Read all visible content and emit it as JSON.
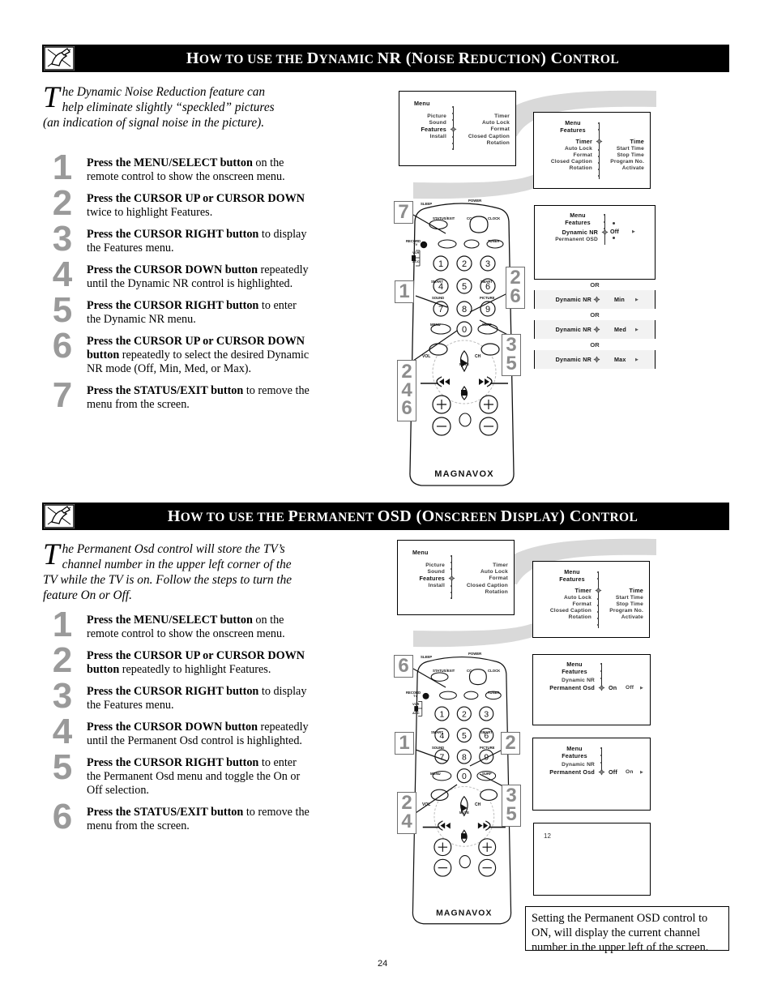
{
  "page": {
    "number": "24"
  },
  "sections": [
    {
      "icon": "tv-manual-icon",
      "title_parts": [
        {
          "t": "H",
          "cap": true
        },
        {
          "t": "OW TO USE THE ",
          "cap": false
        },
        {
          "t": "D",
          "cap": true
        },
        {
          "t": "YNAMIC ",
          "cap": false
        },
        {
          "t": "NR (",
          "cap": true
        },
        {
          "t": "N",
          "cap": true
        },
        {
          "t": "OISE ",
          "cap": false
        },
        {
          "t": "R",
          "cap": true
        },
        {
          "t": "EDUCTION) ",
          "cap": false
        },
        {
          "t": "C",
          "cap": true
        },
        {
          "t": "ONTROL",
          "cap": false
        }
      ],
      "title_plain": "HOW TO USE THE DYNAMIC NR (NOISE REDUCTION) CONTROL",
      "intro_dropcap": "T",
      "intro": "he Dynamic Noise Reduction feature can help eliminate slightly “speckled” pictures (an indication of signal noise in the picture).",
      "steps": [
        {
          "num": "1",
          "bold": "Press the MENU/SELECT button",
          "rest": " on the remote control to show the onscreen menu."
        },
        {
          "num": "2",
          "bold": "Press the CURSOR UP or CURSOR DOWN",
          "rest": " twice to highlight Features."
        },
        {
          "num": "3",
          "bold": "Press the CURSOR RIGHT button",
          "rest": " to display the Features menu."
        },
        {
          "num": "4",
          "bold": "Press the CURSOR DOWN button",
          "rest": " repeatedly until the Dynamic NR control is highlighted."
        },
        {
          "num": "5",
          "bold": "Press the CURSOR RIGHT button",
          "rest": " to enter the Dynamic NR menu."
        },
        {
          "num": "6",
          "bold": "Press the CURSOR UP or CURSOR DOWN button",
          "rest": " repeatedly to select the desired Dynamic NR mode (Off, Min, Med, or Max)."
        },
        {
          "num": "7",
          "bold": "Press the STATUS/EXIT button",
          "rest": " to remove the menu from the screen."
        }
      ]
    },
    {
      "icon": "tv-manual-icon",
      "title_plain": "HOW TO USE THE PERMANENT OSD (ONSCREEN DISPLAY) CONTROL",
      "intro_dropcap": "T",
      "intro": "he Permanent Osd control will store the TV’s channel number in the upper left corner of the TV while the TV is on.  Follow the steps to turn the feature On or Off.",
      "steps": [
        {
          "num": "1",
          "bold": "Press the MENU/SELECT button",
          "rest": " on the remote control to show the onscreen menu."
        },
        {
          "num": "2",
          "bold": "Press the CURSOR UP or CURSOR DOWN button",
          "rest": " repeatedly to highlight Features."
        },
        {
          "num": "3",
          "bold": "Press the CURSOR RIGHT button",
          "rest": " to display the Features menu."
        },
        {
          "num": "4",
          "bold": "Press the CURSOR DOWN button",
          "rest": " repeatedly until the Permanent Osd control is highlighted."
        },
        {
          "num": "5",
          "bold": "Press the CURSOR RIGHT button",
          "rest": " to enter the Permanent Osd menu and toggle the On or Off selection."
        },
        {
          "num": "6",
          "bold": "Press the STATUS/EXIT button",
          "rest": " to remove the menu from the screen."
        }
      ]
    }
  ],
  "osd": {
    "main_menu": {
      "title": "Menu",
      "left_items": [
        "Picture",
        "Sound",
        "Features",
        "Install"
      ],
      "highlighted": "Features",
      "right_items": [
        "Timer",
        "Auto Lock",
        "Format",
        "Closed Caption",
        "Rotation"
      ]
    },
    "features_menu": {
      "breadcrumb": [
        "Menu",
        "Features"
      ],
      "left_items": [
        "Timer",
        "Auto Lock",
        "Format",
        "Closed Caption",
        "Rotation"
      ],
      "highlighted": "Timer",
      "right_items": [
        "Time",
        "Start Time",
        "Stop Time",
        "Program No.",
        "Activate"
      ],
      "right_highlighted": "Time"
    },
    "dnr_menu": {
      "breadcrumb": [
        "Menu",
        "Features"
      ],
      "left_items": [
        "Dynamic NR",
        "Permanent OSD"
      ],
      "highlighted": "Dynamic NR",
      "value": "Off"
    },
    "dnr_options": [
      {
        "label": "Dynamic NR",
        "value": "Min"
      },
      {
        "label": "Dynamic NR",
        "value": "Med"
      },
      {
        "label": "Dynamic NR",
        "value": "Max"
      }
    ],
    "or_label": "OR",
    "osd_on_menu": {
      "breadcrumb": [
        "Menu",
        "Features"
      ],
      "left_items": [
        "Dynamic NR",
        "Permanent Osd"
      ],
      "highlighted": "Permanent Osd",
      "value_selected": "On",
      "value_other": "Off"
    },
    "osd_off_menu": {
      "breadcrumb": [
        "Menu",
        "Features"
      ],
      "left_items": [
        "Dynamic NR",
        "Permanent Osd"
      ],
      "highlighted": "Permanent Osd",
      "value_selected": "Off",
      "value_other": "On"
    },
    "tv_channel_screen": {
      "channel": "12"
    }
  },
  "note": {
    "text": "Setting the Permanent OSD control to ON, will display the current channel number in the upper left of the screen."
  },
  "remote": {
    "brand": "MAGNAVOX",
    "labels": {
      "sleep": "SLEEP",
      "power": "POWER",
      "vcr_rec": "VCR",
      "status_exit": "STATUS/EXIT",
      "cc": "CC",
      "clock": "CLOCK",
      "record": "RECORD",
      "tuner": "TUNER",
      "tv": "TV",
      "vcr": "VCR",
      "acc": "ACC",
      "smart_sound": "SMART",
      "sound": "SOUND",
      "smart_picture": "SMART",
      "picture": "PICTURE",
      "menu": "MENU",
      "surf": "SURF",
      "vol": "VOL",
      "ch": "CH",
      "mute": "MUTE"
    },
    "keypad": [
      "1",
      "2",
      "3",
      "4",
      "5",
      "6",
      "7",
      "8",
      "9",
      "0"
    ]
  },
  "callouts": {
    "s1": [
      {
        "id": "c7",
        "nums": [
          "7"
        ]
      },
      {
        "id": "c1",
        "nums": [
          "1"
        ]
      },
      {
        "id": "c26",
        "nums": [
          "2",
          "6"
        ]
      },
      {
        "id": "c246",
        "nums": [
          "2",
          "4",
          "6"
        ]
      },
      {
        "id": "c35",
        "nums": [
          "3",
          "5"
        ]
      }
    ],
    "s2": [
      {
        "id": "c6",
        "nums": [
          "6"
        ]
      },
      {
        "id": "c1",
        "nums": [
          "1"
        ]
      },
      {
        "id": "c2",
        "nums": [
          "2"
        ]
      },
      {
        "id": "c24",
        "nums": [
          "2",
          "4"
        ]
      },
      {
        "id": "c35",
        "nums": [
          "3",
          "5"
        ]
      }
    ]
  },
  "colors": {
    "header_bg": "#000000",
    "header_fg": "#ffffff",
    "step_number": "#9a9a9a",
    "swoosh": "#d9d9d9",
    "osd_text": "#3a3a3a"
  }
}
